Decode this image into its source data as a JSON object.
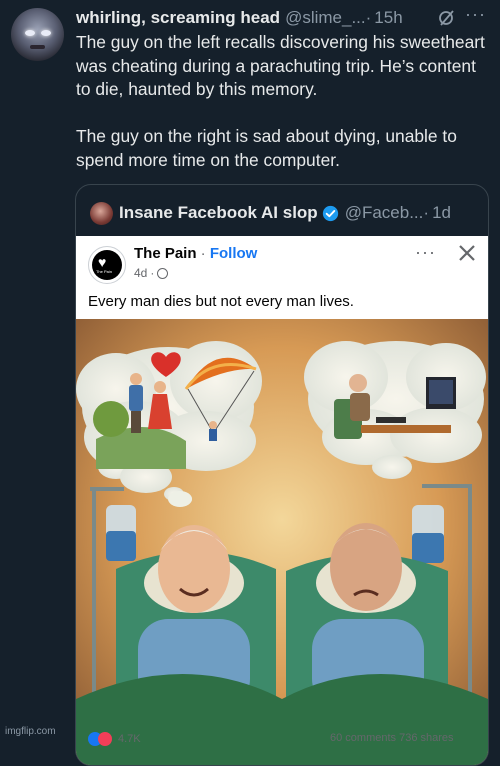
{
  "tweet": {
    "author_name": "whirling, screaming head",
    "author_handle": "@slime_...",
    "separator": "·",
    "time": "15h",
    "more_glyph": "···",
    "paragraphs": [
      "The guy on the left recalls discovering his sweetheart was cheating during a parachuting trip. He’s content to die, haunted by this memory.",
      "The guy on the right is sad about dying, unable to spend more time on the computer."
    ]
  },
  "quote": {
    "author_name": "Insane Facebook AI slop",
    "author_handle": "@Faceb...",
    "separator": "·",
    "time": "1d",
    "verified_color": "#1d9bf0"
  },
  "facebook_post": {
    "page_name": "The Pain",
    "logo_text": "The Pain",
    "separator": " · ",
    "follow_label": "Follow",
    "age": "4d",
    "meta_sep": "·",
    "more_glyph": "···",
    "caption": "Every man dies but not every man lives.",
    "reactions_count": "4.7K",
    "shares_text": "60 comments  736 shares"
  },
  "footer": {
    "watermark": "imgflip.com"
  },
  "colors": {
    "background": "#15202b",
    "text": "#e7e9ea",
    "muted": "#8b98a5",
    "border": "#38444d",
    "facebook_blue": "#1877f2"
  }
}
